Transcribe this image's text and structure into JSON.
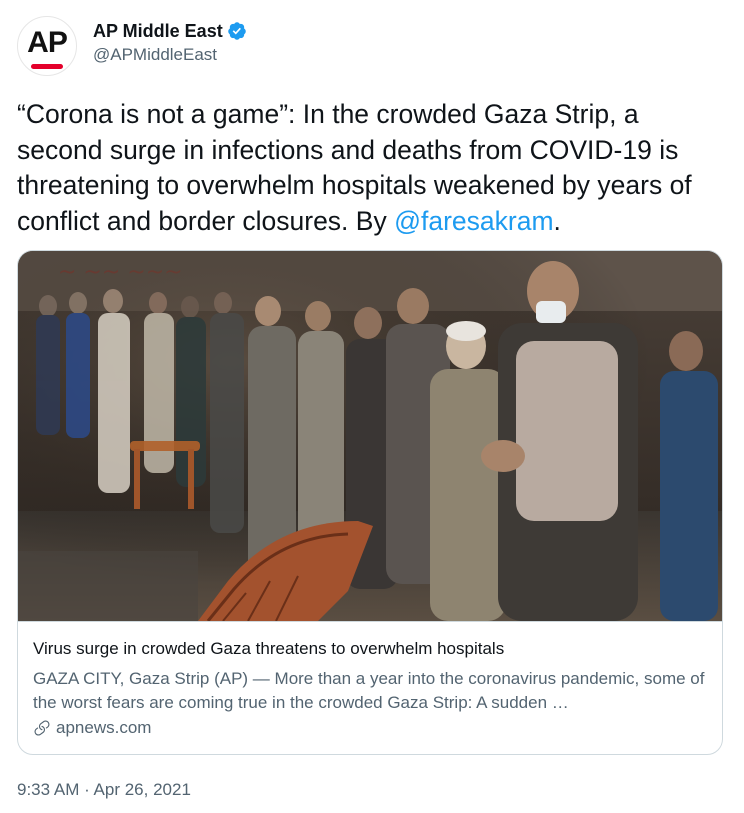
{
  "author": {
    "avatar_text": "AP",
    "display_name": "AP Middle East",
    "handle": "@APMiddleEast",
    "verified": true,
    "avatar_icon": "ap-logo-icon",
    "brand_red": "#e4002b",
    "verified_color": "#1d9bf0"
  },
  "tweet": {
    "text_before_mention": "“Corona is not a game”: In the crowded Gaza Strip, a second surge in infections and deaths from COVID-19 is threatening to overwhelm hospitals weakened by years of conflict and border closures. By ",
    "mention": "@faresakram",
    "text_after_mention": ".",
    "link_color": "#1d9bf0"
  },
  "card": {
    "image_icon": "photo-icon",
    "title": "Virus surge in crowded Gaza threatens to overwhelm hospitals",
    "description": "GAZA CITY, Gaza Strip (AP) — More than a year into the coronavirus pandemic, some of the worst fears are coming true in the crowded Gaza Strip: A sudden …",
    "domain": "apnews.com",
    "domain_icon": "link-icon"
  },
  "timestamp": "9:33 AM · Apr 26, 2021"
}
